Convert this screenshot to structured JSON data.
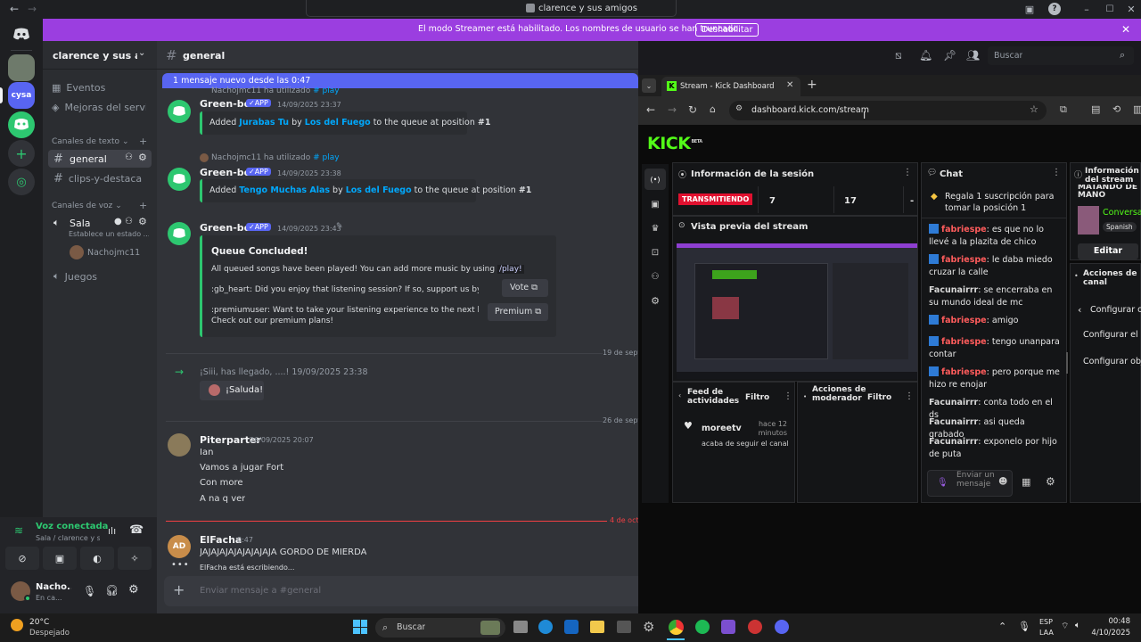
{
  "titlebar": {
    "title": "clarence y sus amigos"
  },
  "streamer_bar": {
    "message": "El modo Streamer está habilitado. Los nombres de usuario se han truncado.",
    "button": "Deshabilitar"
  },
  "server": {
    "name": "clarence y sus ami...",
    "guild_abbrev": "cysa"
  },
  "sidebar": {
    "events": "Eventos",
    "boosts": "Mejoras del servi...",
    "text_category": "Canales de texto",
    "text_channels": [
      "general",
      "clips-y-destaca..."
    ],
    "voice_category": "Canales de voz",
    "voice_channel": "Sala",
    "voice_status": "Establece un estado ...",
    "voice_user": "Nachojmc11",
    "games": "Juegos"
  },
  "voice_panel": {
    "title": "Voz conectada",
    "subtitle": "Sala / clarence y s..."
  },
  "user_panel": {
    "name": "Nacho...",
    "status": "En ca..."
  },
  "header": {
    "channel": "general",
    "search_placeholder": "Buscar"
  },
  "new_messages_bar": "1 mensaje nuevo desde las 0:47",
  "messages": {
    "ref1_user": "Nachojmc11 ha utilizado",
    "ref1_cmd": "play",
    "bot_name": "Green-bot",
    "app_badge": "APP",
    "m1_ts": "14/09/2025 23:37",
    "m1_pre": "Added ",
    "m1_song": "Jurabas Tu",
    "m1_by": " by ",
    "m1_artist": "Los del Fuego",
    "m1_post": " to the queue at position ",
    "m1_pos": "#1",
    "ref2_user": "Nachojmc11 ha utilizado",
    "ref2_cmd": "play",
    "m2_ts": "14/09/2025 23:38",
    "m2_pre": "Added ",
    "m2_song": "Tengo Muchas Alas",
    "m2_by": " by ",
    "m2_artist": "Los del Fuego",
    "m2_post": " to the queue at position ",
    "m2_pos": "#1",
    "m3_ts": "14/09/2025 23:43",
    "queue_title": "Queue Concluded!",
    "queue_text": "All queued songs have been played! You can add more music by using ",
    "queue_cmd": "/play!",
    "heart_text": ":gb_heart: Did you enjoy that listening session? If so, support us by voting!",
    "vote_button": "Vote",
    "premium_text1": ":premiumuser: Want to take your listening experience to the next level?",
    "premium_text2": "Check out our premium plans!",
    "premium_button": "Premium",
    "divider1": "19 de sept",
    "join_text": "¡Siii, has llegado, ....! 19/09/2025 23:38",
    "wave_label": "¡Saluda!",
    "divider2": "26 de sept",
    "piter_name": "Piterparter",
    "piter_ts": "26/09/2025 20:07",
    "piter_lines": [
      "Ian",
      "Vamos a jugar Fort",
      "Con more",
      "A na q ver"
    ],
    "divider3": "4 de oct",
    "elfacha_name": "ElFacha",
    "elfacha_ts": "0:47",
    "elfacha_text": "JAJAJAJAJAJAJAJAJA GORDO DE MIERDA",
    "typing": "ElFacha está escribiendo..."
  },
  "composer": {
    "placeholder": "Enviar mensaje a #general"
  },
  "browser": {
    "tab_title": "Stream - Kick Dashboard",
    "url": "dashboard.kick.com/stream",
    "logo": "KICK",
    "logo_beta": "BETA",
    "session_title": "Información de la sesión",
    "live_badge": "TRANSMITIENDO",
    "stat1": "7",
    "stat2": "17",
    "stat3": "-",
    "preview_title": "Vista previa del stream",
    "activity_title": "Feed de actividades",
    "filter": "Filtro",
    "activity_user": "moreetv",
    "activity_time": "hace 12 minutos",
    "activity_action": "acaba de seguir el canal",
    "mod_title": "Acciones de moderador",
    "filter2": "Filtro",
    "chat_title": "Chat",
    "pinned": "Regala 1 suscripción para tomar la posición 1",
    "chat_input": "Enviar un mensaje",
    "info_title": "Información del stream",
    "info_cut": "MATANDO DE",
    "info_mano": "MANO",
    "info_category": "Conversa",
    "info_lang": "Spanish",
    "edit_button": "Editar",
    "actions_title": "Acciones de canal",
    "configure_back": "Configurar o",
    "configure1": "Configurar el c",
    "configure2": "Configurar obj"
  },
  "chat_messages": [
    {
      "user": "fabriespe",
      "text": "es que no lo llevé a la plazita de chico"
    },
    {
      "user": "fabriespe",
      "text": "le daba miedo cruzar la calle"
    },
    {
      "user": "Facunairrr",
      "text": "se encerraba en su mundo ideal de mc"
    },
    {
      "user": "fabriespe",
      "text": "amigo"
    },
    {
      "user": "fabriespe",
      "text": "tengo unanpara contar"
    },
    {
      "user": "fabriespe",
      "text": "pero porque me hizo re enojar"
    },
    {
      "user": "Facunairrr",
      "text": "conta todo en el ds"
    },
    {
      "user": "Facunairrr",
      "text": "asi queda grabado"
    },
    {
      "user": "Facunairrr",
      "text": "exponelo por hijo de puta"
    }
  ],
  "taskbar": {
    "temp": "20°C",
    "weather": "Despejado",
    "search": "Buscar",
    "lang1": "ESP",
    "lang2": "LAA",
    "time": "00:48",
    "date": "4/10/2025"
  }
}
